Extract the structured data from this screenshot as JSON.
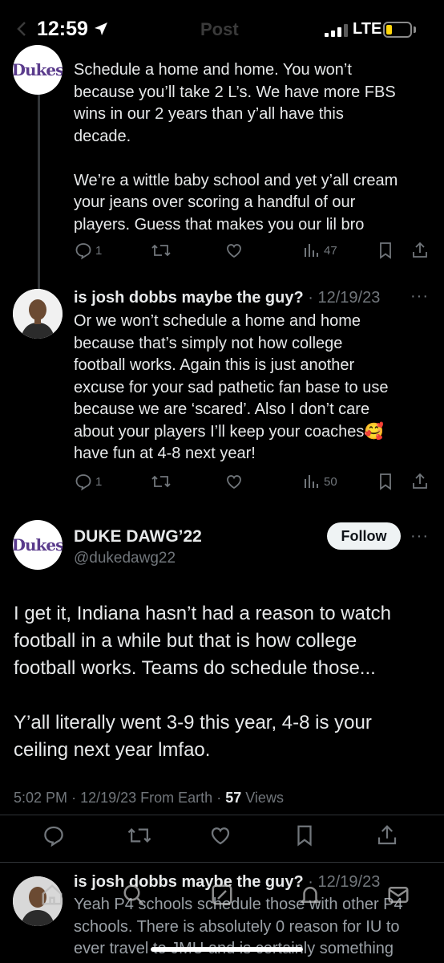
{
  "status_bar": {
    "time": "12:59",
    "network": "LTE"
  },
  "header": {
    "title": "Post"
  },
  "reply_1": {
    "author_logo": "Dukes",
    "lines": [
      "Schedule a home and home. You won’t",
      "because you’ll take 2 L’s. We have more FBS",
      "wins in our 2 years than y’all have this",
      "decade.",
      "",
      "We’re a wittle baby school and yet y’all cream",
      "your jeans over scoring a handful of our",
      "players. Guess that makes you our lil bro"
    ],
    "replies": "1",
    "views": "47"
  },
  "reply_2": {
    "name": "is josh dobbs maybe the guy?",
    "date": "· 12/19/23",
    "lines": [
      "Or we won’t schedule a home and home",
      "because that’s simply not how college",
      "football works. Again this is just another",
      "excuse for your sad pathetic fan base to use",
      "because we are ‘scared’. Also I don’t care",
      "about your players I’ll keep your coaches🥰",
      "have fun at 4-8 next year!"
    ],
    "replies": "1",
    "views": "50"
  },
  "main_tweet": {
    "author_logo": "Dukes",
    "name": "DUKE DAWG’22",
    "handle": "@dukedawg22",
    "follow_label": "Follow",
    "lines": [
      "I get it, Indiana hasn’t had a reason to watch",
      "football in a while but that is how college",
      "football works. Teams do schedule those...",
      "",
      "Y’all literally went 3-9 this year, 4-8 is your",
      "ceiling next year lmfao."
    ],
    "time": "5:02 PM",
    "date": "12/19/23",
    "source": "From Earth",
    "views_count": "57",
    "views_label": "Views"
  },
  "reply_3": {
    "name": "is josh dobbs maybe the guy?",
    "date": "· 12/19/23",
    "lines": [
      "Yeah P4 schools schedule those with other P4",
      "schools. There is absolutely 0 reason for IU to",
      "ever travel to JMU and is certainly something"
    ]
  },
  "colors": {
    "accent": "#1d9bf0",
    "muted": "#71767b",
    "text": "#e7e9ea",
    "battery": "#ffd60a",
    "dukes_purple": "#5a3b8c"
  },
  "icons": [
    "location-arrow-icon",
    "signal-icon",
    "battery-icon",
    "reply-icon",
    "retweet-icon",
    "like-icon",
    "views-icon",
    "bookmark-icon",
    "share-icon",
    "home-icon",
    "search-icon",
    "compose-icon",
    "notifications-icon",
    "messages-icon"
  ]
}
